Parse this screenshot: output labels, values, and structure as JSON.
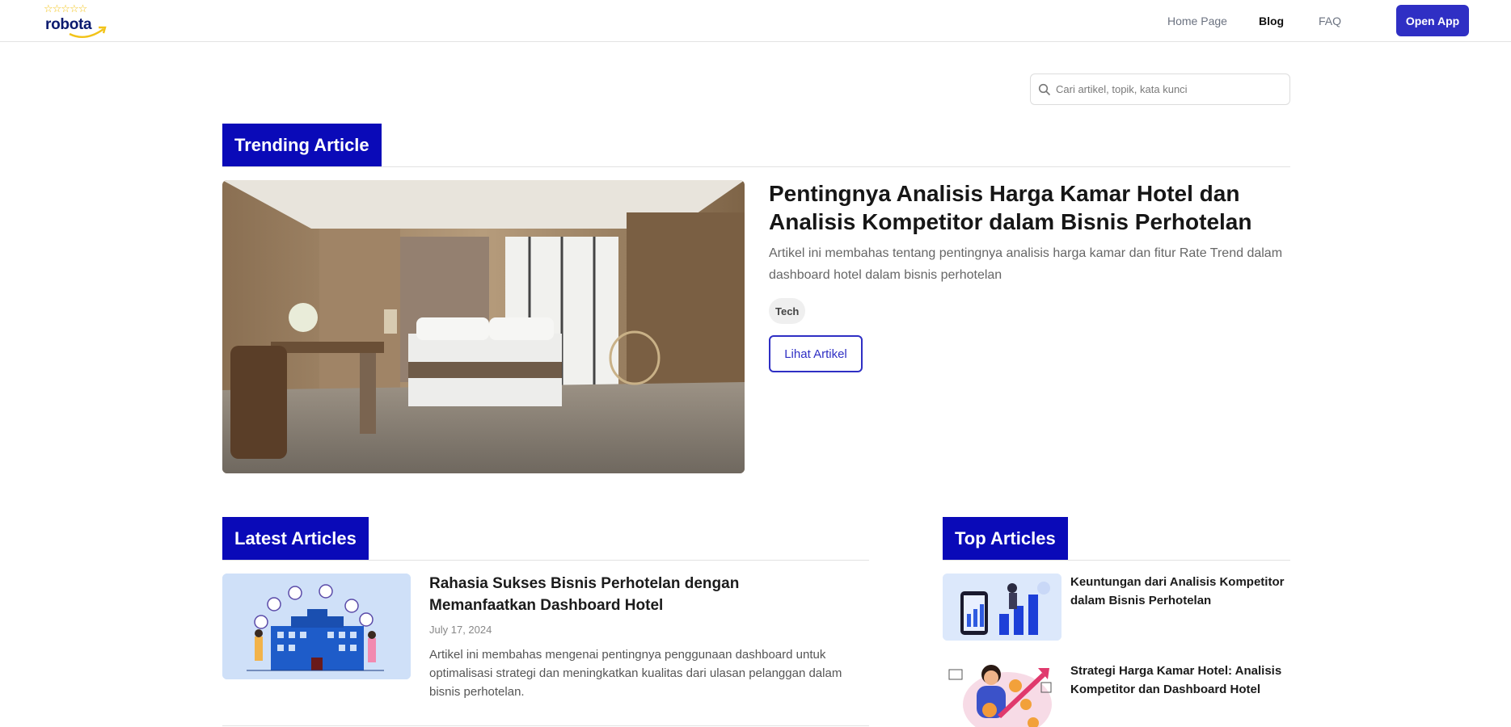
{
  "header": {
    "logo_text": "robota",
    "nav": {
      "home": "Home Page",
      "blog": "Blog",
      "faq": "FAQ"
    },
    "open_app": "Open App"
  },
  "search": {
    "placeholder": "Cari artikel, topik, kata kunci",
    "value": ""
  },
  "trending": {
    "heading": "Trending Article",
    "title": "Pentingnya Analisis Harga Kamar Hotel dan Analisis Kompetitor dalam Bisnis Perhotelan",
    "description": "Artikel ini membahas tentang pentingnya analisis harga kamar dan fitur Rate Trend dalam dashboard hotel dalam bisnis perhotelan",
    "tag": "Tech",
    "button": "Lihat Artikel"
  },
  "latest": {
    "heading": "Latest Articles",
    "items": [
      {
        "title": "Rahasia Sukses Bisnis Perhotelan dengan Memanfaatkan Dashboard Hotel",
        "date": "July 17, 2024",
        "description": "Artikel ini membahas mengenai pentingnya penggunaan dashboard untuk optimalisasi strategi dan meningkatkan kualitas dari ulasan pelanggan dalam bisnis perhotelan."
      }
    ]
  },
  "top": {
    "heading": "Top Articles",
    "items": [
      {
        "title": "Keuntungan dari Analisis Kompetitor dalam Bisnis Perhotelan"
      },
      {
        "title": "Strategi Harga Kamar Hotel: Analisis Kompetitor dan Dashboard Hotel"
      }
    ]
  },
  "colors": {
    "brand_blue": "#0a0ab8",
    "button_blue": "#2f2fc4",
    "star_yellow": "#f2c318"
  }
}
